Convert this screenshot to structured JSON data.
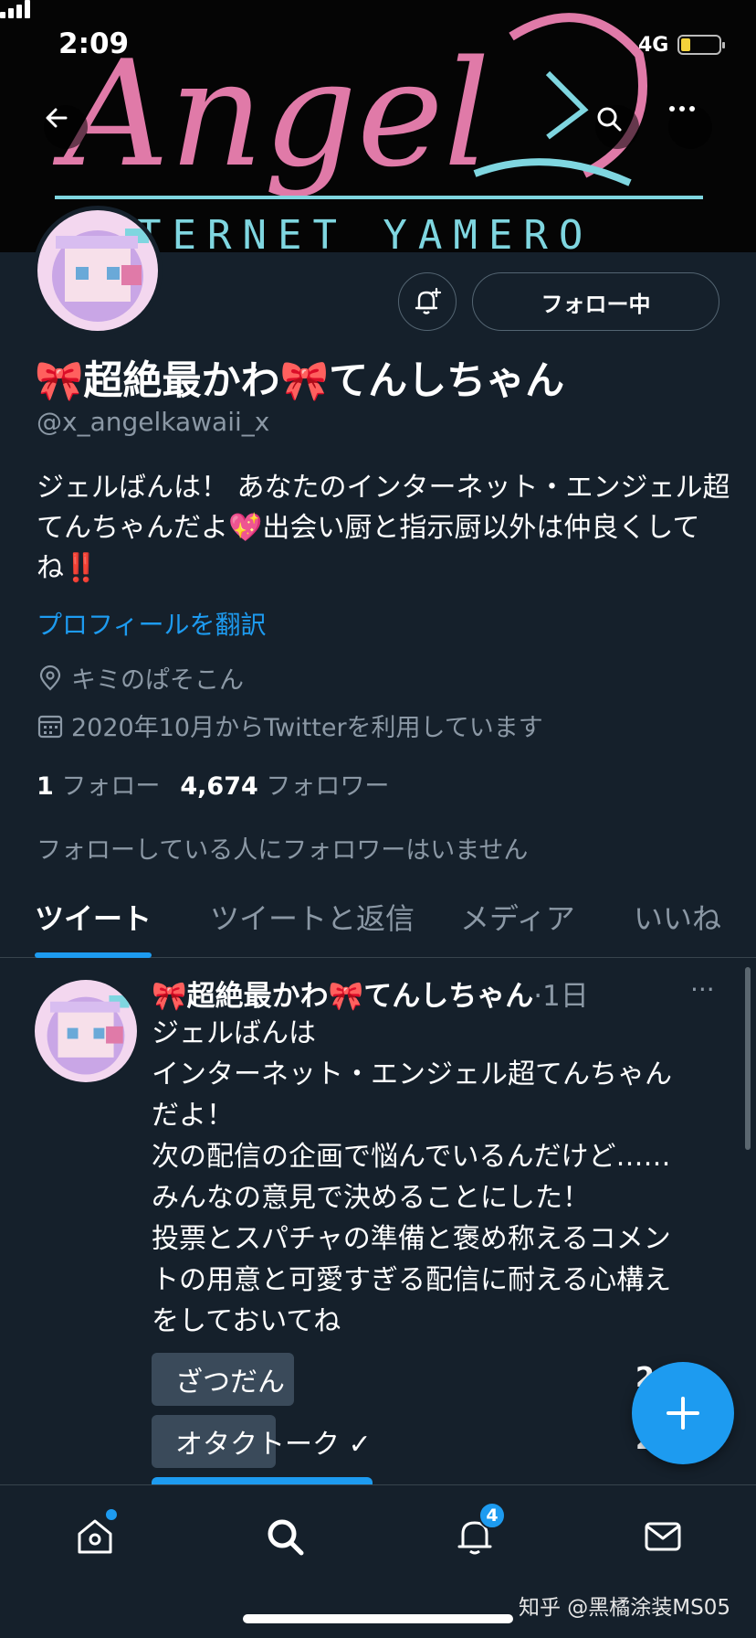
{
  "status": {
    "time": "2:09",
    "network": "4G"
  },
  "banner": {
    "title_art": "Angel",
    "subtitle_art": "TERNET YAMERO"
  },
  "profile": {
    "name": "🎀超絶最かわ🎀てんしちゃん",
    "handle": "@x_angelkawaii_x",
    "bio": "ジェルばんは！ あなたのインターネット・エンジェル超てんちゃんだよ💖出会い厨と指示厨以外は仲良くしてね‼️",
    "translate_label": "プロフィールを翻訳",
    "location": "キミのぱそこん",
    "joined": "2020年10月からTwitterを利用しています",
    "following_count": "1",
    "following_label": "フォロー",
    "followers_count": "4,674",
    "followers_label": "フォロワー",
    "mutual_note": "フォローしている人にフォロワーはいません",
    "follow_button": "フォロー中"
  },
  "tabs": [
    {
      "label": "ツイート"
    },
    {
      "label": "ツイートと返信"
    },
    {
      "label": "メディア"
    },
    {
      "label": "いいね"
    }
  ],
  "tweet": {
    "author": "🎀超絶最かわ🎀てんしちゃん",
    "time": "·1日",
    "more": "···",
    "lines": [
      "ジェルばんは",
      "インターネット・エンジェル超てんちゃん",
      "だよ！",
      "次の配信の企画で悩んでいるんだけど……",
      "みんなの意見で決めることにした！",
      "投票とスパチャの準備と褒め称えるコメン",
      "トの用意と可愛すぎる配信に耐える心構え",
      "をしておいてね"
    ],
    "poll": [
      {
        "label": "ざつだん",
        "pct": "2",
        "fill": 0.29
      },
      {
        "label": "オタクトーク ✓",
        "pct": "2",
        "fill": 0.28
      }
    ]
  },
  "nav": {
    "notifications_badge": "4"
  },
  "watermark": "知乎 @黑橘涂装MS05",
  "colors": {
    "accent": "#1d9bf0",
    "bg": "#15202b",
    "muted": "#8b98a5",
    "banner_pink": "#e07aa8",
    "banner_cyan": "#7fd6e0"
  }
}
